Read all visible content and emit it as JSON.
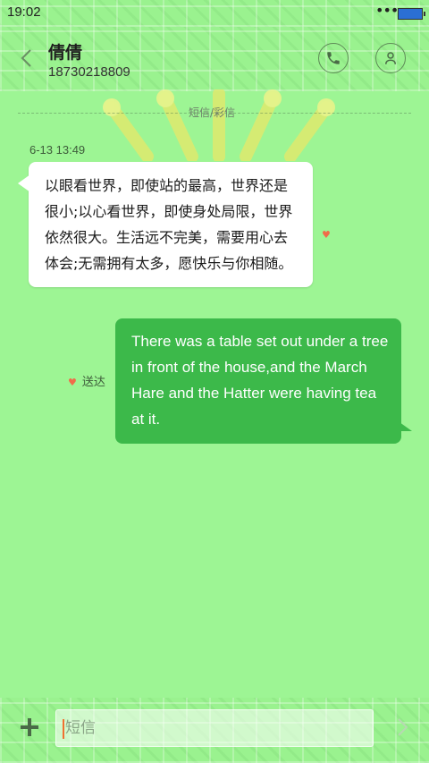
{
  "status_bar": {
    "time": "19:02",
    "dots": "•••"
  },
  "header": {
    "back_icon": "chevron-left-icon",
    "contact_name": "倩倩",
    "contact_number": "18730218809",
    "call_icon": "phone-icon",
    "profile_icon": "person-icon"
  },
  "conversation": {
    "divider_label": "短信/彩信",
    "messages": [
      {
        "direction": "incoming",
        "timestamp": "6-13 13:49",
        "text": "以眼看世界，即使站的最高，世界还是很小;以心看世界，即使身处局限，世界依然很大。生活远不完美，需要用心去体会;无需拥有太多，愿快乐与你相随。"
      },
      {
        "direction": "outgoing",
        "status": "送达",
        "text": "There was a table set out under a tree in front of the house,and the March Hare and the Hatter were having tea at it."
      }
    ]
  },
  "composer": {
    "placeholder": "短信",
    "value": "",
    "add_icon": "plus-icon",
    "send_icon": "send-arrow-icon"
  },
  "colors": {
    "background": "#9df594",
    "outgoing_bubble": "#3cb94a",
    "incoming_bubble": "#ffffff",
    "heart": "#f06c4a"
  }
}
